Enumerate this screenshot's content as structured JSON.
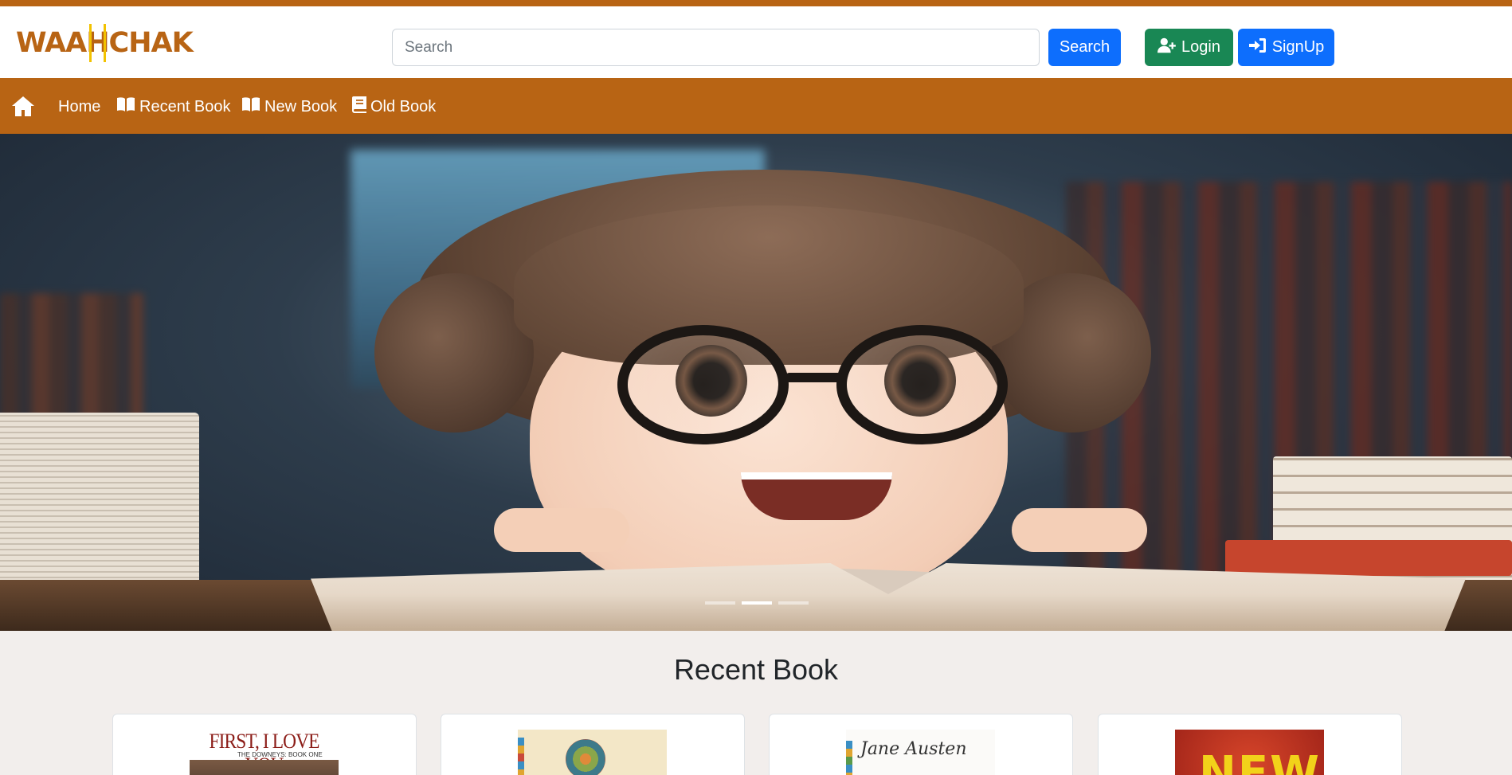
{
  "header": {
    "logo_text": "WAAHCHAK",
    "search": {
      "placeholder": "Search",
      "value": ""
    },
    "search_button": "Search",
    "login_button": "Login",
    "signup_button": "SignUp"
  },
  "nav": {
    "items": [
      {
        "label": "Home",
        "icon": "home-icon"
      },
      {
        "label": "Recent Book",
        "icon": "book-open-icon"
      },
      {
        "label": "New Book",
        "icon": "book-open-icon"
      },
      {
        "label": "Old Book",
        "icon": "book-icon"
      }
    ]
  },
  "carousel": {
    "slides": 3,
    "active_index": 1
  },
  "recent": {
    "title": "Recent Book",
    "books": [
      {
        "cover_title": "FIRST, I LOVE YOU",
        "cover_subtitle": "THE DOWNEYS: BOOK ONE"
      },
      {
        "cover_title": ""
      },
      {
        "cover_title": "Jane Austen"
      },
      {
        "cover_title": "NEW"
      }
    ]
  },
  "colors": {
    "brand": "#b86414",
    "primary": "#0d6efd",
    "success": "#198754",
    "page_bg": "#f2eeec"
  }
}
